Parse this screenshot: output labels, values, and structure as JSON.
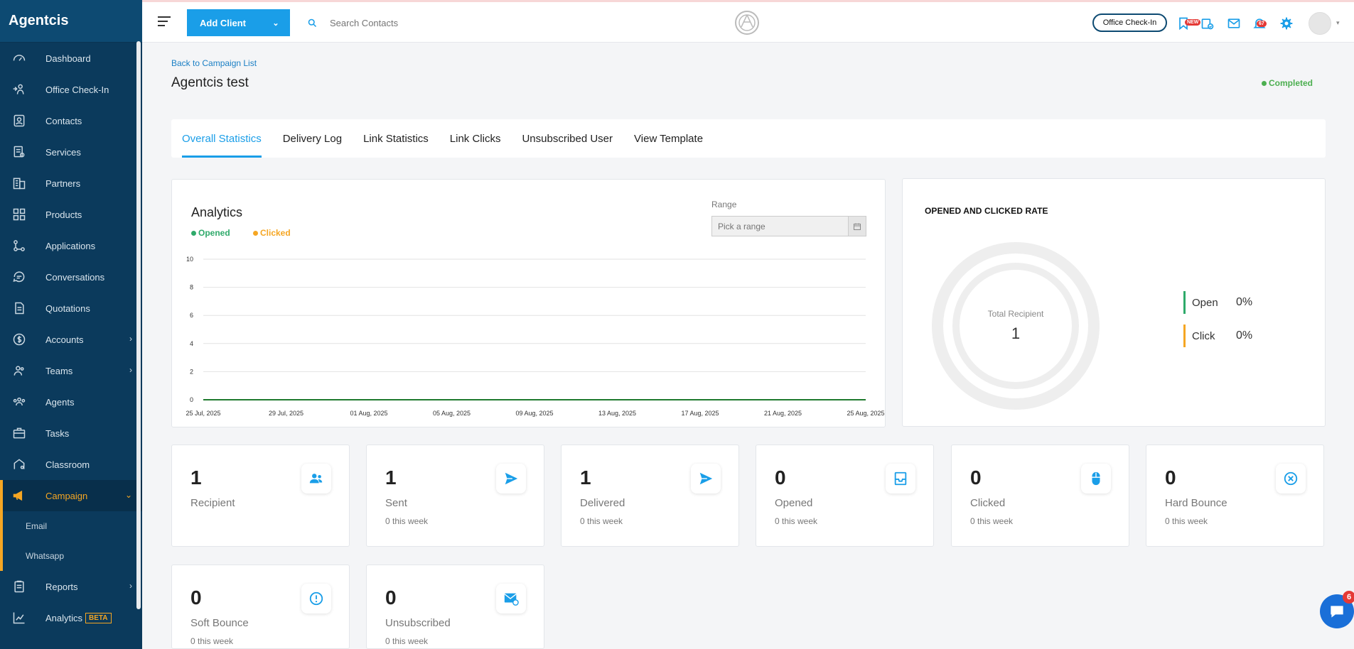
{
  "app": {
    "brand": "Agentcis"
  },
  "sidebar": {
    "items": [
      {
        "label": "Dashboard"
      },
      {
        "label": "Office Check-In"
      },
      {
        "label": "Contacts"
      },
      {
        "label": "Services"
      },
      {
        "label": "Partners"
      },
      {
        "label": "Products"
      },
      {
        "label": "Applications"
      },
      {
        "label": "Conversations"
      },
      {
        "label": "Quotations"
      },
      {
        "label": "Accounts"
      },
      {
        "label": "Teams"
      },
      {
        "label": "Agents"
      },
      {
        "label": "Tasks"
      },
      {
        "label": "Classroom"
      },
      {
        "label": "Campaign"
      },
      {
        "label": "Reports"
      },
      {
        "label": "Analytics",
        "badge": "BETA"
      }
    ],
    "campaign_sub": [
      {
        "label": "Email"
      },
      {
        "label": "Whatsapp"
      }
    ]
  },
  "topbar": {
    "add_client": "Add Client",
    "search_placeholder": "Search Contacts",
    "office_checkin": "Office Check-In",
    "new_badge": "NEW",
    "notif_count": "67"
  },
  "page": {
    "back_link": "Back to Campaign List",
    "title": "Agentcis test",
    "status": "Completed"
  },
  "tabs": [
    {
      "label": "Overall Statistics"
    },
    {
      "label": "Delivery Log"
    },
    {
      "label": "Link Statistics"
    },
    {
      "label": "Link Clicks"
    },
    {
      "label": "Unsubscribed User"
    },
    {
      "label": "View Template"
    }
  ],
  "analytics": {
    "title": "Analytics",
    "legend_opened": "Opened",
    "legend_clicked": "Clicked",
    "range_label": "Range",
    "range_placeholder": "Pick a range"
  },
  "chart_data": {
    "type": "line",
    "x": [
      "25 Jul, 2025",
      "29 Jul, 2025",
      "01 Aug, 2025",
      "05 Aug, 2025",
      "09 Aug, 2025",
      "13 Aug, 2025",
      "17 Aug, 2025",
      "21 Aug, 2025",
      "25 Aug, 2025"
    ],
    "y_ticks": [
      0,
      2,
      4,
      6,
      8,
      10
    ],
    "ylim": [
      0,
      10
    ],
    "series": [
      {
        "name": "Opened",
        "color": "#2eaa6a",
        "values": [
          0,
          0,
          0,
          0,
          0,
          0,
          0,
          0,
          0
        ]
      },
      {
        "name": "Clicked",
        "color": "#f5a623",
        "values": [
          0,
          0,
          0,
          0,
          0,
          0,
          0,
          0,
          0
        ]
      }
    ],
    "grid": true,
    "legend": "top-left"
  },
  "rate": {
    "title": "OPENED AND CLICKED RATE",
    "total_label": "Total Recipient",
    "total_value": "1",
    "open_label": "Open",
    "open_pct": "0%",
    "click_label": "Click",
    "click_pct": "0%"
  },
  "stats": [
    {
      "value": "1",
      "label": "Recipient",
      "week": "",
      "icon": "users-icon"
    },
    {
      "value": "1",
      "label": "Sent",
      "week": "0 this week",
      "icon": "send-icon"
    },
    {
      "value": "1",
      "label": "Delivered",
      "week": "0 this week",
      "icon": "send-icon"
    },
    {
      "value": "0",
      "label": "Opened",
      "week": "0 this week",
      "icon": "inbox-icon"
    },
    {
      "value": "0",
      "label": "Clicked",
      "week": "0 this week",
      "icon": "mouse-icon"
    },
    {
      "value": "0",
      "label": "Hard Bounce",
      "week": "0 this week",
      "icon": "x-circle-icon"
    },
    {
      "value": "0",
      "label": "Soft Bounce",
      "week": "0 this week",
      "icon": "alert-circle-icon"
    },
    {
      "value": "0",
      "label": "Unsubscribed",
      "week": "0 this week",
      "icon": "mail-icon"
    }
  ],
  "chat": {
    "badge": "6"
  },
  "colors": {
    "accent": "#1a9ee8",
    "sidebar": "#0b3a5c",
    "campaign": "#f5a623",
    "success": "#4caf50"
  }
}
